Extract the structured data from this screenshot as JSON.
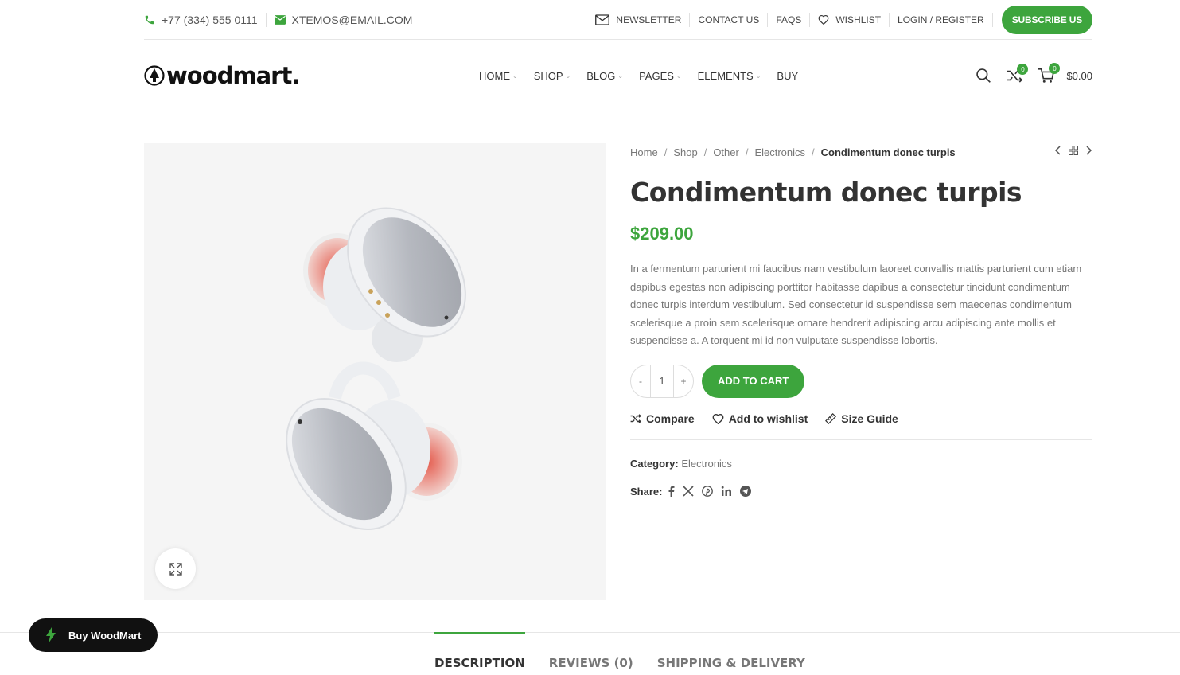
{
  "topbar": {
    "phone": "+77 (334) 555 0111",
    "email": "XTEMOS@EMAIL.COM",
    "links": {
      "newsletter": "NEWSLETTER",
      "contact": "CONTACT US",
      "faqs": "FAQS",
      "wishlist": "WISHLIST",
      "login": "LOGIN / REGISTER"
    },
    "subscribe_label": "SUBSCRIBE US"
  },
  "header": {
    "logo_text": "woodmart.",
    "nav": {
      "home": "HOME",
      "shop": "SHOP",
      "blog": "BLOG",
      "pages": "PAGES",
      "elements": "ELEMENTS",
      "buy": "BUY"
    },
    "compare_count": "0",
    "cart_count": "0",
    "cart_total": "$0.00"
  },
  "breadcrumbs": {
    "home": "Home",
    "shop": "Shop",
    "other": "Other",
    "electronics": "Electronics",
    "current": "Condimentum donec turpis",
    "separator": "/"
  },
  "product": {
    "title": "Condimentum donec turpis",
    "price": "$209.00",
    "description": "In a fermentum parturient mi faucibus nam vestibulum laoreet convallis mattis parturient cum etiam dapibus egestas non adipiscing porttitor habitasse dapibus a consectetur tincidunt condimentum donec turpis interdum vestibulum. Sed consectetur id suspendisse sem maecenas condimentum scelerisque a proin sem scelerisque ornare hendrerit adipiscing arcu adipiscing ante mollis et suspendisse a. A torquent mi id non vulputate suspendisse lobortis.",
    "quantity": "1",
    "qty_minus": "-",
    "qty_plus": "+",
    "add_to_cart": "ADD TO CART",
    "compare": "Compare",
    "wishlist": "Add to wishlist",
    "size_guide": "Size Guide",
    "category_label": "Category:",
    "category_value": "Electronics",
    "share_label": "Share:"
  },
  "tabs": {
    "description": "DESCRIPTION",
    "reviews": "REVIEWS (0)",
    "shipping": "SHIPPING & DELIVERY"
  },
  "buy_float_label": "Buy WoodMart",
  "colors": {
    "accent": "#3da53d",
    "dark": "#111111"
  }
}
